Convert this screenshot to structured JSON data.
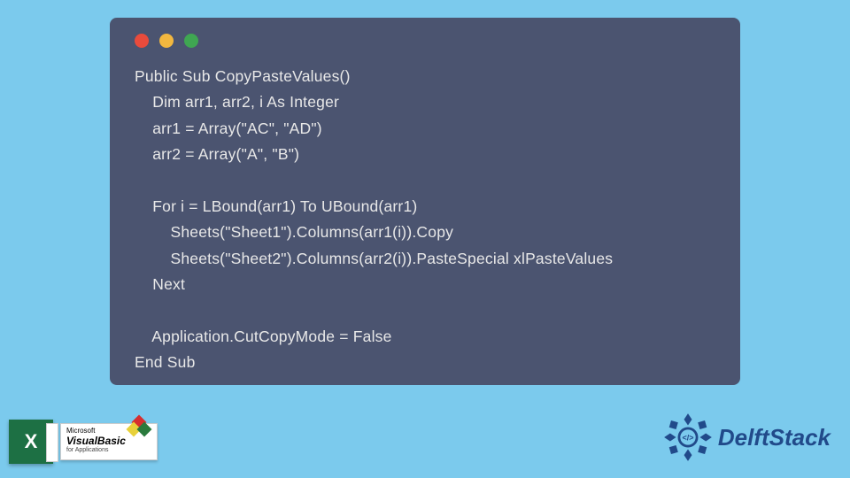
{
  "code": {
    "l1": "Public Sub CopyPasteValues()",
    "l2": "    Dim arr1, arr2, i As Integer",
    "l3": "    arr1 = Array(\"AC\", \"AD\")",
    "l4": "    arr2 = Array(\"A\", \"B\")",
    "l5": "",
    "l6": "    For i = LBound(arr1) To UBound(arr1)",
    "l7": "        Sheets(\"Sheet1\").Columns(arr1(i)).Copy",
    "l8": "        Sheets(\"Sheet2\").Columns(arr2(i)).PasteSpecial xlPasteValues",
    "l9": "    Next",
    "l10": "",
    "l11": "    Application.CutCopyMode = False",
    "l12": "End Sub"
  },
  "footer": {
    "excel_letter": "X",
    "vb_line1": "Microsoft",
    "vb_line2": "VisualBasic",
    "vb_line3": "for Applications",
    "brand": "DelftStack"
  }
}
